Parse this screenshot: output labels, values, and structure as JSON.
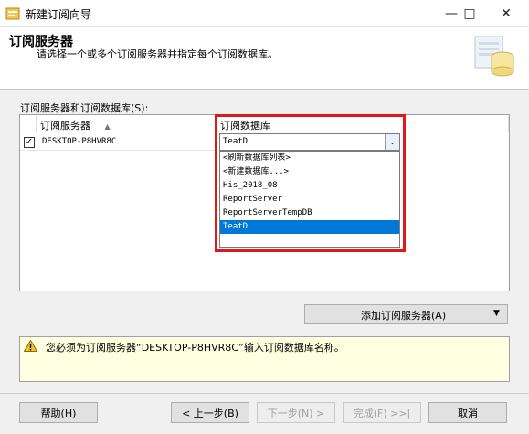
{
  "window": {
    "title": "新建订阅向导",
    "controls": [
      "minimize-icon",
      "maximize-icon",
      "close-icon"
    ]
  },
  "header": {
    "title": "订阅服务器",
    "subtitle": "请选择一个或多个订阅服务器并指定每个订阅数据库。"
  },
  "grid": {
    "label": "订阅服务器和订阅数据库(S):",
    "columns": [
      "订阅服务器",
      "订阅数据库"
    ],
    "sort_icon": "sort-up-triangle-icon",
    "rows": [
      {
        "checked": true,
        "subscriber": "DESKTOP-P8HVR8C",
        "database": "TeatD"
      }
    ]
  },
  "dropdown": {
    "selected": "TeatD",
    "options": [
      "<刷新数据库列表>",
      "<新建数据库...>",
      "His_2018_08",
      "ReportServer",
      "ReportServerTempDB",
      "TeatD"
    ],
    "highlighted": "TeatD"
  },
  "add_button": {
    "label": "添加订阅服务器(A)"
  },
  "message": {
    "icon": "warning-icon",
    "text": "您必须为订阅服务器“DESKTOP-P8HVR8C”输入订阅数据库名称。"
  },
  "footer": {
    "help": "帮助(H)",
    "back": "< 上一步(B)",
    "next": "下一步(N) >",
    "finish": "完成(F) >>|",
    "cancel": "取消"
  },
  "colors": {
    "highlight": "#0078d7",
    "annotation_box": "#e01818",
    "message_bg": "#ffffe1"
  }
}
